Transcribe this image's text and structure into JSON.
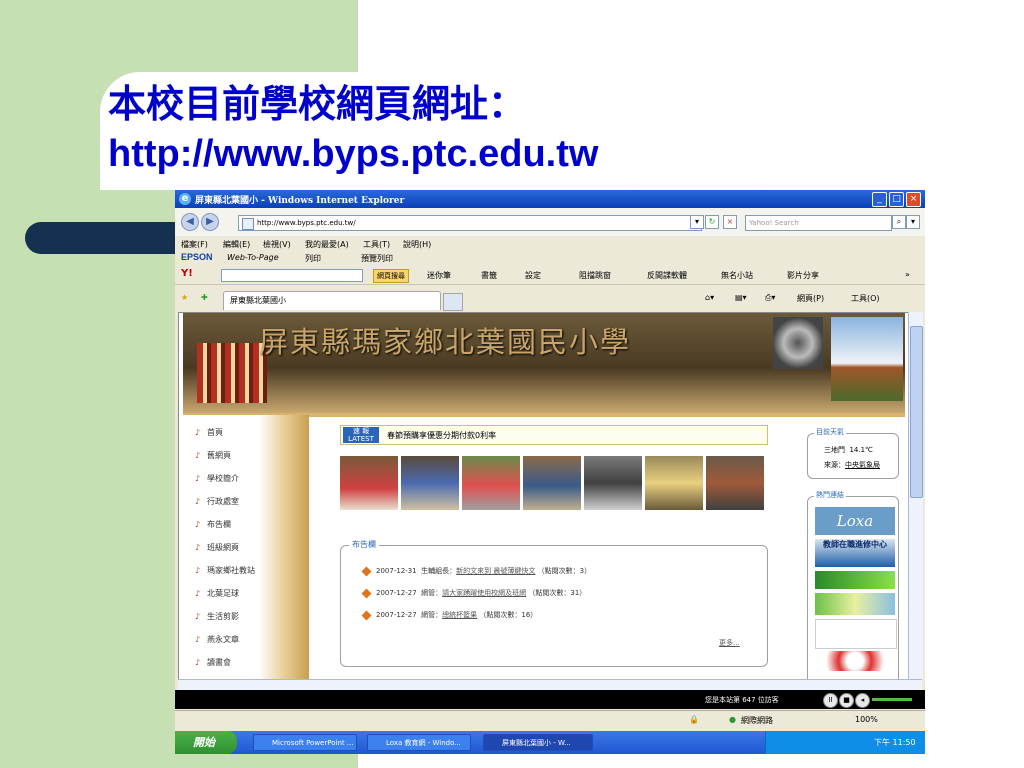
{
  "slide": {
    "title": "本校目前學校網頁網址：",
    "url": "http://www.byps.ptc.edu.tw"
  },
  "browser": {
    "window_title": "屏東縣北葉國小 - Windows Internet Explorer",
    "address": "http://www.byps.ptc.edu.tw/",
    "search_placeholder": "Yahoo! Search",
    "menu": [
      "檔案(F)",
      "編輯(E)",
      "檢視(V)",
      "我的最愛(A)",
      "工具(T)",
      "說明(H)"
    ],
    "epson_label": "EPSON",
    "web_to_page": "Web-To-Page",
    "print": "列印",
    "print_preview": "預覽列印",
    "yahoo_logo": "Y!",
    "web_search_button": "網頁搜尋",
    "yahoo_tools": [
      "迷你筆",
      "書籤",
      "設定",
      "阻擋跳窗",
      "反間諜軟體",
      "無名小站",
      "影片分享"
    ],
    "tab_title": "屏東縣北葉國小",
    "command_bar": [
      "網頁(P)",
      "工具(O)"
    ],
    "status_zone": "網際網路",
    "zoom": "100%"
  },
  "site": {
    "school_name": "屏東縣瑪家鄉北葉國民小學",
    "nav": [
      "首頁",
      "舊網頁",
      "學校簡介",
      "行政處室",
      "布告欄",
      "班級網頁",
      "瑪家鄉社教站",
      "北葉足球",
      "生活剪影",
      "燕永文章",
      "讀書會"
    ],
    "news_badge_top": "速 報",
    "news_badge_bottom": "LATEST",
    "news_text": "春節預購享優惠分期付款0利率",
    "board_title": "布告欄",
    "posts": [
      {
        "date": "2007-12-31",
        "author": "生輔組長",
        "title": "新的文來到 晨號薄鍵快文",
        "clicks": "（點閱次數：3）"
      },
      {
        "date": "2007-12-27",
        "author": "網管",
        "title": "請大家踴躍使用校網及班網",
        "clicks": "（點閱次數：31）"
      },
      {
        "date": "2007-12-27",
        "author": "網管",
        "title": "總統杯籃果",
        "clicks": "（點閱次數：16）"
      }
    ],
    "more": "更多...",
    "weather_title": "目前天氣",
    "weather_location": "三地門",
    "weather_temp": "14.1℃",
    "weather_source_label": "來源：",
    "weather_source": "中央氣象局",
    "hot_links_title": "熱門連結",
    "hot_links": [
      "Loxa",
      "教師在職進修中心",
      "",
      "",
      "",
      ""
    ],
    "visitor": "您是本站第 647 位訪客"
  },
  "taskbar": {
    "start": "開始",
    "tasks": [
      "Microsoft PowerPoint ...",
      "Loxa 教育網 - Windo...",
      "屏東縣北葉國小 - W..."
    ],
    "clock": "下午 11:50"
  },
  "colors": {
    "slide_text": "#0000cc",
    "slide_green": "#c6e0b4",
    "slide_bar": "#14324f",
    "taskbar": "#2057d2"
  }
}
